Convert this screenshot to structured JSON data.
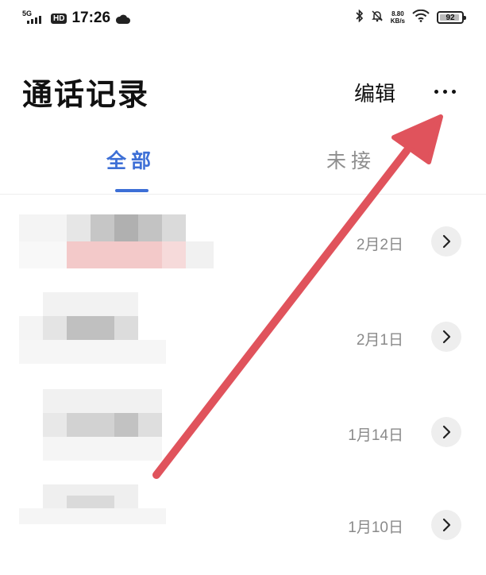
{
  "status_bar": {
    "network": "5G",
    "hd_badge": "HD",
    "time": "17:26",
    "speed_value": "8.80",
    "speed_unit": "KB/s",
    "battery": "92"
  },
  "header": {
    "title": "通话记录",
    "edit_label": "编辑"
  },
  "tabs": [
    {
      "label": "全部",
      "active": true
    },
    {
      "label": "未接",
      "active": false
    }
  ],
  "calls": [
    {
      "date": "2月2日"
    },
    {
      "date": "2月1日"
    },
    {
      "date": "1月14日"
    },
    {
      "date": "1月10日"
    }
  ],
  "colors": {
    "accent": "#3d6fd6",
    "annotation_arrow": "#e0535c"
  }
}
